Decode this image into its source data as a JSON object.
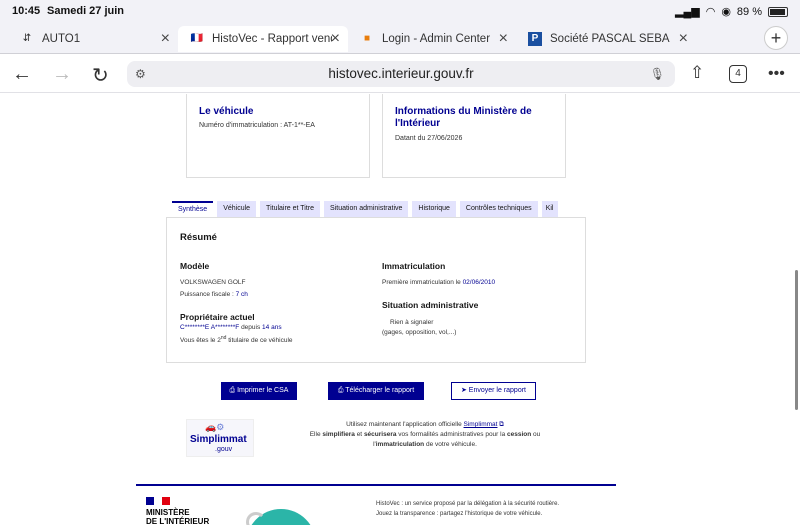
{
  "status": {
    "time": "10:45",
    "date": "Samedi 27 juin",
    "battery": "89 %"
  },
  "tabs": [
    {
      "label": "AUTO1",
      "favicon": "⇵"
    },
    {
      "label": "HistoVec - Rapport vend",
      "favicon": "🇫🇷"
    },
    {
      "label": "Login - Admin Center",
      "favicon": "■"
    },
    {
      "label": "Société PASCAL SEBAS",
      "favicon": "P"
    }
  ],
  "browser": {
    "url": "histovec.interieur.gouv.fr",
    "tab_count": "4"
  },
  "cards": {
    "vehicule": {
      "title": "Le véhicule",
      "subtitle": "Numéro d'immatriculation : AT-1**-EA"
    },
    "ministere": {
      "title": "Informations du Ministère de l'Intérieur",
      "subtitle": "Datant du 27/06/2026"
    }
  },
  "vehicle_tabs": [
    "Synthèse",
    "Véhicule",
    "Titulaire et Titre",
    "Situation administrative",
    "Historique",
    "Contrôles techniques",
    "Kil"
  ],
  "synthese": {
    "title": "Résumé",
    "modele_label": "Modèle",
    "modele_value": "VOLKSWAGEN GOLF",
    "puissance_prefix": "Puissance fiscale : ",
    "puissance_value": "7 ch",
    "proprietaire_label": "Propriétaire actuel",
    "proprietaire_name": "C********E A********F",
    "proprietaire_depuis": " depuis ",
    "proprietaire_years": "14 ans",
    "titulaire_prefix": "Vous êtes le 2",
    "titulaire_sup": "nd",
    "titulaire_suffix": " titulaire de ce véhicule",
    "immat_label": "Immatriculation",
    "immat_prefix": "Première immatriculation le ",
    "immat_date": "02/06/2010",
    "situation_label": "Situation administrative",
    "situation_value": "Rien à signaler",
    "situation_detail": "(gages, opposition, vol,...)"
  },
  "actions": {
    "imprimer": "Imprimer le CSA",
    "telecharger": "Télécharger le rapport",
    "envoyer": "Envoyer le rapport"
  },
  "promo": {
    "logo_main": "Simplimmat",
    "logo_sub": ".gouv",
    "line1_prefix": "Utilisez maintenant l'application officielle ",
    "line1_link": "Simplimmat",
    "line2_a": "Elle ",
    "line2_b": "simplifiera",
    "line2_c": " et ",
    "line2_d": "sécurisera",
    "line2_e": " vos formalités administratives pour la ",
    "line2_f": "cession",
    "line2_g": " ou",
    "line3_a": "l'",
    "line3_b": "immatriculation",
    "line3_c": " de votre véhicule."
  },
  "footer": {
    "ministere_line1": "MINISTÈRE",
    "ministere_line2": "DE L'INTÉRIEUR",
    "text1": "HistoVec : un service proposé par la délégation à la sécurité routière.",
    "text2": "Jouez la transparence : partagez l'historique de votre véhicule."
  },
  "colors": {
    "primary": "#000091",
    "tab_bg": "#e3e3fd",
    "flag_blue": "#000091",
    "flag_red": "#e1000f"
  }
}
